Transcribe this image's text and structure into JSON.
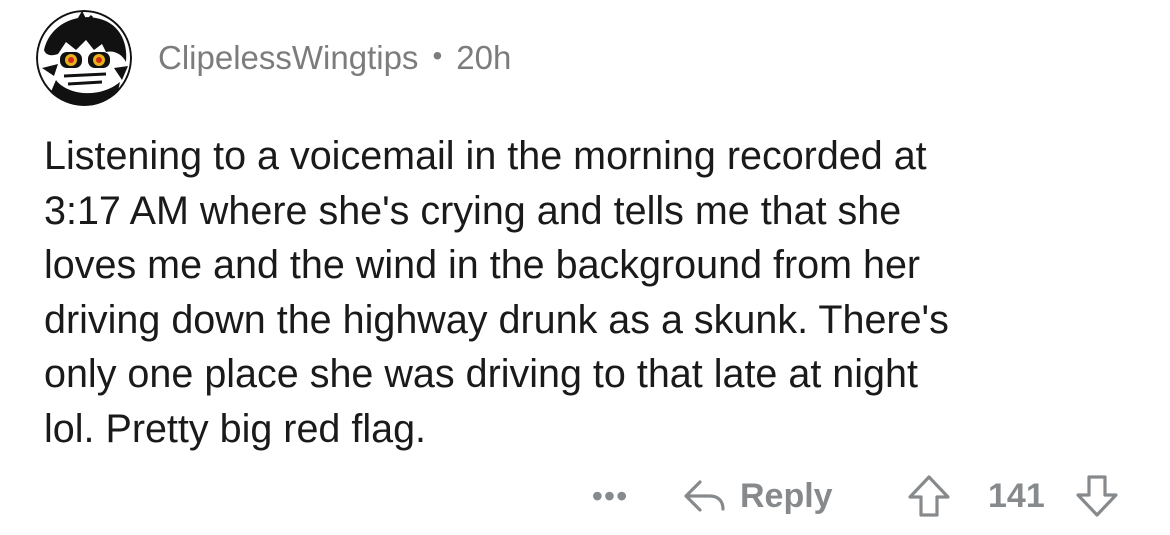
{
  "comment": {
    "author": "ClipelessWingtips",
    "separator": "•",
    "age": "20h",
    "avatar_icon": "avatar-icon",
    "body_lines": [
      "Listening to a voicemail in the morning recorded at",
      "3:17 AM where she's crying and tells me that she",
      "loves me and the wind in the background from her",
      "driving down the highway drunk as a skunk. There's",
      "only one place she was driving to that late at night",
      "lol. Pretty big red flag."
    ]
  },
  "actions": {
    "more_label": "•••",
    "more_icon": "more-options-icon",
    "reply_label": "Reply",
    "reply_icon": "reply-arrow-icon",
    "upvote_icon": "upvote-arrow-icon",
    "score": "141",
    "downvote_icon": "downvote-arrow-icon"
  },
  "colors": {
    "text": "#1a1a1b",
    "meta": "#7c7c7c",
    "action": "#878a8c",
    "background": "#ffffff"
  }
}
